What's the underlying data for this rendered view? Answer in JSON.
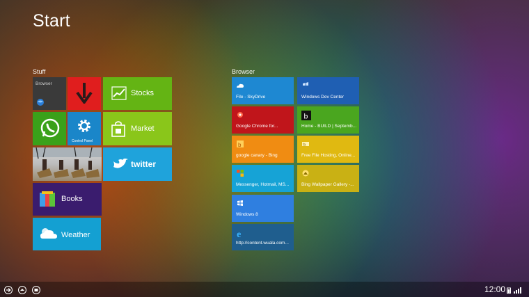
{
  "screen_title": "Start",
  "groups": {
    "stuff": "Stuff",
    "browser": "Browser"
  },
  "stuff_tiles": {
    "browser": "Browser",
    "control_panel": "Control Panel",
    "stocks": "Stocks",
    "market": "Market",
    "twitter": "twitter",
    "books": "Books",
    "weather": "Weather"
  },
  "browser_tiles": [
    {
      "label": "File - SkyDrive",
      "color": "#1e88d2"
    },
    {
      "label": "Windows Dev Center",
      "color": "#1f5fb3"
    },
    {
      "label": "Google Chrome for...",
      "color": "#c0151b"
    },
    {
      "label": "Home - BUILD | Septemb...",
      "color": "#4aa61f"
    },
    {
      "label": "google canary - Bing",
      "color": "#f08c12"
    },
    {
      "label": "Free File Hosting, Online...",
      "color": "#e0b911"
    },
    {
      "label": "Messenger, Hotmail, MS...",
      "color": "#16a3d6"
    },
    {
      "label": "Bing Wallpaper Gallery -...",
      "color": "#c9b114"
    },
    {
      "label": "Windows 8",
      "color": "#2f7fe0"
    },
    {
      "label": "http://content.wuala.com...",
      "color": "#1f5e8e"
    }
  ],
  "taskbar": {
    "time": "12:00"
  },
  "colors": {
    "stocks": "#64b414",
    "market": "#8ac61a",
    "twitter": "#1fa3db",
    "books": "#3a1c6e",
    "weather": "#14a0d2",
    "arrow": "#e01e1e",
    "whatsapp": "#3aa11a",
    "control_panel": "#1a86c9"
  }
}
